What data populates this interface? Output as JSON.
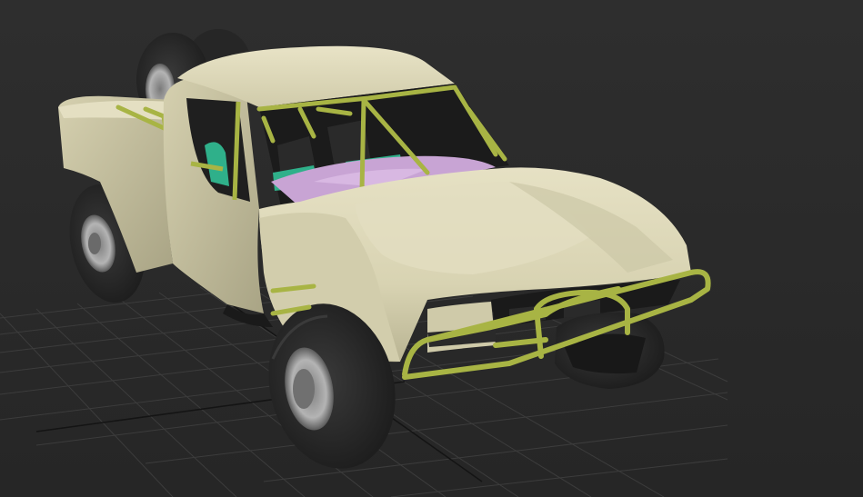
{
  "viewport": {
    "view_type": "perspective",
    "shading": "smooth-shaded",
    "grid_visible": true
  },
  "colors": {
    "background": "#2b2b2b",
    "grid_line": "#3f3f3f",
    "grid_axis": "#111111",
    "body_paint": "#d8d3b2",
    "roll_cage": "#a8b444",
    "tire": "#2a2a2a",
    "rim": "#9a9a9a",
    "seat": "#2fb08a",
    "floor": "#c8a4d4"
  },
  "model": {
    "object": "trophy-truck",
    "wheel_count": 4,
    "spare_tire_count": 2
  }
}
